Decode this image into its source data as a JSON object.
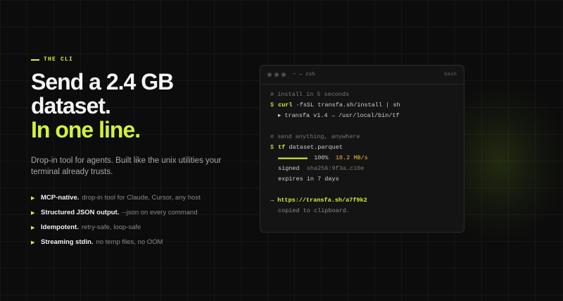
{
  "eyebrow": "THE CLI",
  "headline": {
    "line1": "Send a 2.4 GB",
    "line2": "dataset.",
    "line3": "In one line."
  },
  "subtitle": "Drop-in tool for agents. Built like the unix utilities your terminal already trusts.",
  "features": [
    {
      "title": "MCP-native.",
      "desc": "drop-in tool for Claude, Cursor, any host"
    },
    {
      "title": "Structured JSON output.",
      "desc": "--json on every command"
    },
    {
      "title": "Idempotent.",
      "desc": "retry-safe, loop-safe"
    },
    {
      "title": "Streaming stdin.",
      "desc": "no temp files, no OOM"
    }
  ],
  "terminal": {
    "title": "~ — zsh",
    "shell": "bash",
    "comment1": "# install in 5 seconds",
    "prompt": "$",
    "cmd1": "curl",
    "args1": "-fsSL transfa.sh/install | sh",
    "out1": "▸ transfa v1.4 → /usr/local/bin/tf",
    "comment2": "# send anything, anywhere",
    "cmd2": "tf",
    "args2": "dataset.parquet",
    "progress_bar": "▬▬▬▬▬▬▬▬▬▬",
    "progress_pct": "100%",
    "progress_speed": "18.2 MB/s",
    "signed_label": "signed",
    "signed_hash": "sha256:9f3a…c10e",
    "expires": "expires in 7 days",
    "link_arrow": "→",
    "link": "https://transfa.sh/a7f9k2",
    "copied": "copied to clipboard."
  },
  "colors": {
    "accent": "#d4f23a",
    "speed": "#f0b848",
    "background": "#0c0c0c"
  }
}
